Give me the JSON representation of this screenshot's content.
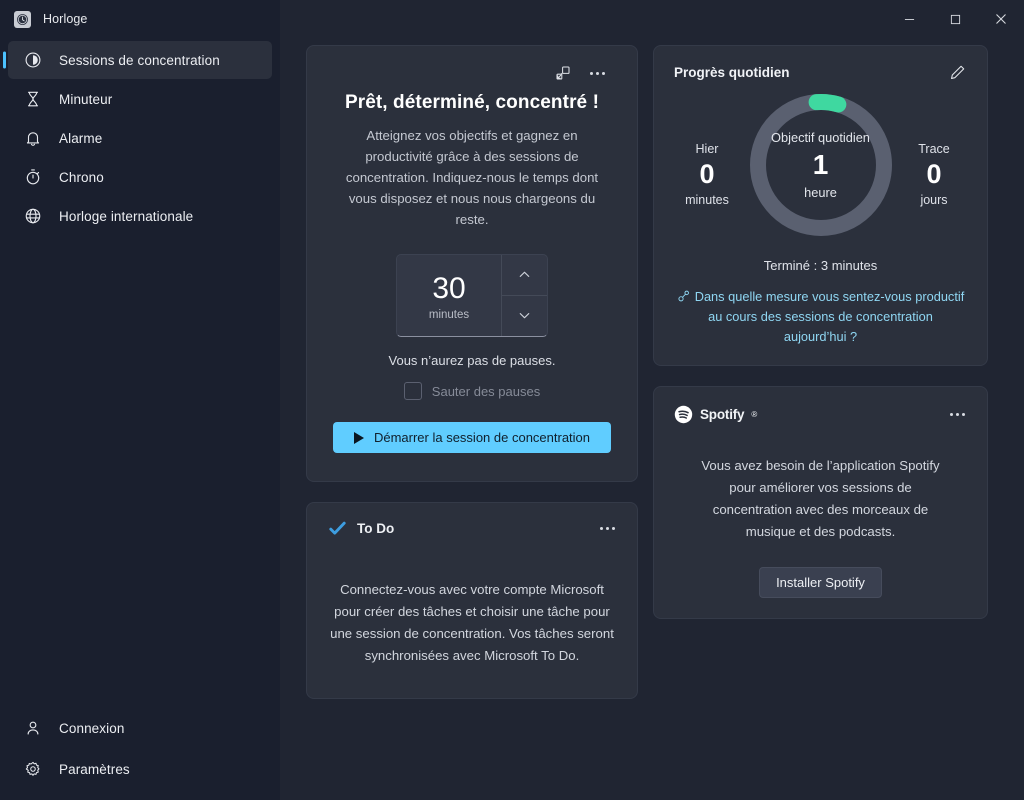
{
  "window": {
    "app_title": "Horloge",
    "app_icon": "clock-icon",
    "minimize_label": "—",
    "maximize_label": "□",
    "close_label": "✕"
  },
  "sidebar": {
    "items": [
      {
        "label": "Sessions de concentration",
        "icon": "focus-sessions-icon",
        "active": true
      },
      {
        "label": "Minuteur",
        "icon": "timer-icon",
        "active": false
      },
      {
        "label": "Alarme",
        "icon": "alarm-bell-icon",
        "active": false
      },
      {
        "label": "Chrono",
        "icon": "stopwatch-icon",
        "active": false
      },
      {
        "label": "Horloge internationale",
        "icon": "world-clock-icon",
        "active": false
      }
    ],
    "bottom_items": [
      {
        "label": "Connexion",
        "icon": "person-icon"
      },
      {
        "label": "Paramètres",
        "icon": "gear-icon"
      }
    ]
  },
  "focus_card": {
    "popout_icon": "pop-out-icon",
    "more_icon": "more-options-icon",
    "heading": "Prêt, déterminé, concentré !",
    "description": "Atteignez vos objectifs et gagnez en productivité grâce à des sessions de concentration. Indiquez-nous le temps dont vous disposez et nous nous chargeons du reste.",
    "duration_value": "30",
    "duration_unit": "minutes",
    "increment_icon": "chevron-up-icon",
    "decrement_icon": "chevron-down-icon",
    "pause_note": "Vous n’aurez pas de pauses.",
    "skip_breaks_label": "Sauter des pauses",
    "skip_breaks_checked": false,
    "start_button_label": "Démarrer la session de concentration",
    "start_button_icon": "play-icon",
    "accent_color": "#60cdff"
  },
  "todo_card": {
    "brand_icon": "todo-check-icon",
    "brand": "To Do",
    "more_icon": "more-options-icon",
    "body": "Connectez-vous avec votre compte Microsoft pour créer des tâches et choisir une tâche pour une session de concentration. Vos tâches seront synchronisées avec Microsoft To Do."
  },
  "progress_card": {
    "title": "Progrès quotidien",
    "edit_icon": "pencil-edit-icon",
    "yesterday": {
      "label": "Hier",
      "value": "0",
      "unit": "minutes"
    },
    "goal": {
      "label": "Objectif quotidien",
      "value": "1",
      "unit": "heure"
    },
    "streak": {
      "label": "Trace",
      "value": "0",
      "unit": "jours"
    },
    "completed": "Terminé : 3 minutes",
    "survey_icon": "survey-icon",
    "survey_link": "Dans quelle mesure vous sentez-vous productif au cours des sessions de concentration aujourd’hui ?",
    "ring_progress_percent": 5,
    "ring_progress_color": "#3fd8a0",
    "ring_track_color": "#5a6070",
    "link_color": "#8fd6f2"
  },
  "spotify_card": {
    "brand_icon": "spotify-logo-icon",
    "brand": "Spotify",
    "more_icon": "more-options-icon",
    "body": "Vous avez besoin de l’application Spotify pour améliorer vos sessions de concentration avec des morceaux de musique et des podcasts.",
    "install_button_label": "Installer Spotify"
  }
}
